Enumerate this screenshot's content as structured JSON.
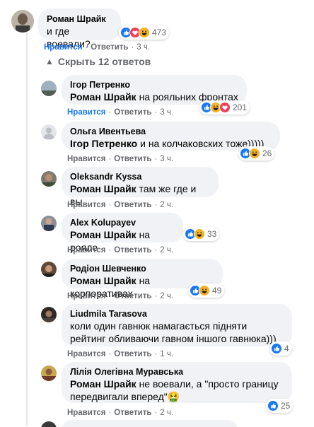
{
  "thread": {
    "root": {
      "author": "Роман Шрайк",
      "text": "и где воевали?",
      "reaction_count": "473",
      "actions": {
        "like": "Нравится",
        "reply": "Ответить",
        "time": "3 ч."
      }
    },
    "toggle_replies": "Скрыть 12 ответов",
    "replies": [
      {
        "author": "Ігор Петренко",
        "mention": "Роман Шрайк",
        "text": " на рояльних фронтах",
        "reaction_count": "201",
        "like": "Нравится",
        "reply": "Ответить",
        "time": "3 ч."
      },
      {
        "author": "Ольга Ивентьева",
        "mention": "Ігор Петренко",
        "text": " и на колчаковских тоже)))))",
        "reaction_count": "26",
        "like": "Нравится",
        "reply": "Ответить",
        "time": "3 ч."
      },
      {
        "author": "Oleksandr Kyssa",
        "mention": "Роман Шрайк",
        "text": " там же где и вы",
        "like": "Нравится",
        "reply": "Ответить",
        "time": "2 ч."
      },
      {
        "author": "Alex Kolupayev",
        "mention": "Роман Шрайк",
        "text": " на рояле",
        "reaction_count": "33",
        "like": "Нравится",
        "reply": "Ответить",
        "time": "2 ч."
      },
      {
        "author": "Родіон Шевченко",
        "mention": "Роман Шрайк",
        "text": " на корпоративах",
        "reaction_count": "49",
        "like": "Нравится",
        "reply": "Ответить",
        "time": "2 ч."
      },
      {
        "author": "Liudmila Tarasova",
        "text_line1": "коли один гавнюк намагається підняти",
        "text_line2": "рейтинг обливаючи гавном іншого гавнюка)))",
        "reaction_count": "4",
        "like": "Нравится",
        "reply": "Ответить",
        "time": "1 ч."
      },
      {
        "author": "Лілія Олегівна Муравська",
        "mention": "Роман Шрайк",
        "text_line1": " не воевали, а \"просто границу",
        "text_line2": "передвигали вперед\"",
        "emoji": "🤮",
        "reaction_count": "25",
        "like": "Нравится",
        "reply": "Ответить",
        "time": "2 ч."
      }
    ]
  },
  "colors": {
    "bubble": "#f0f2f5",
    "meta": "#65676b",
    "liked": "#1877f2",
    "like": "#1877f2",
    "love": "#f33e58",
    "haha": "#f7b125"
  },
  "icons": [
    "like-icon",
    "love-icon",
    "haha-icon",
    "hide-arrow-icon"
  ]
}
